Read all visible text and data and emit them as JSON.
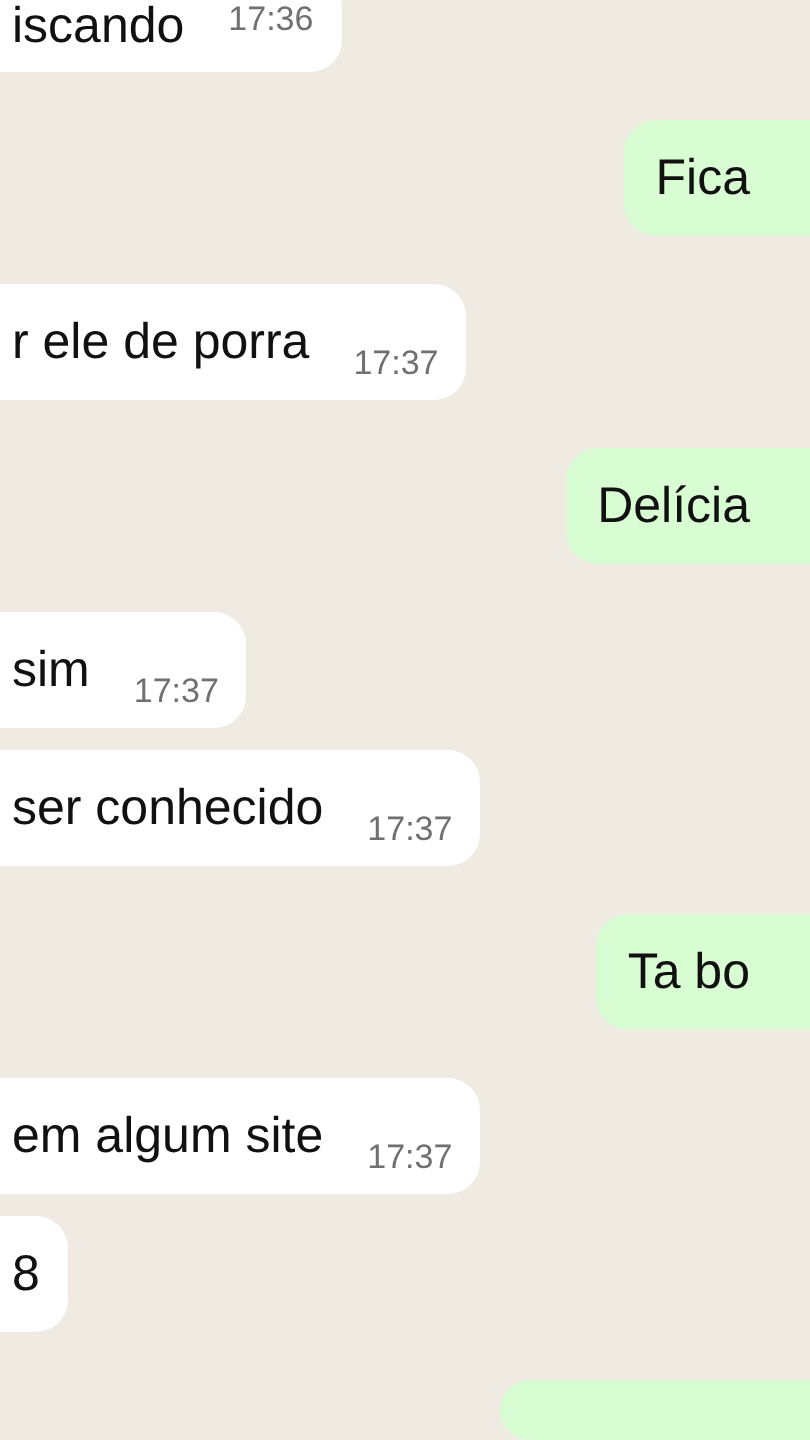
{
  "messages": [
    {
      "kind": "in",
      "text": "iscando",
      "time": "17:36"
    },
    {
      "kind": "out",
      "text": "Fica"
    },
    {
      "kind": "in",
      "text": "r ele de porra",
      "time": "17:37"
    },
    {
      "kind": "out",
      "text": "Delícia"
    },
    {
      "kind": "in",
      "text": "sim",
      "time": "17:37"
    },
    {
      "kind": "in",
      "text": "ser conhecido",
      "time": "17:37"
    },
    {
      "kind": "out",
      "text": "Ta bo"
    },
    {
      "kind": "in",
      "text": "em algum site",
      "time": "17:37"
    },
    {
      "kind": "in",
      "text": "8"
    },
    {
      "kind": "out_cut"
    }
  ]
}
